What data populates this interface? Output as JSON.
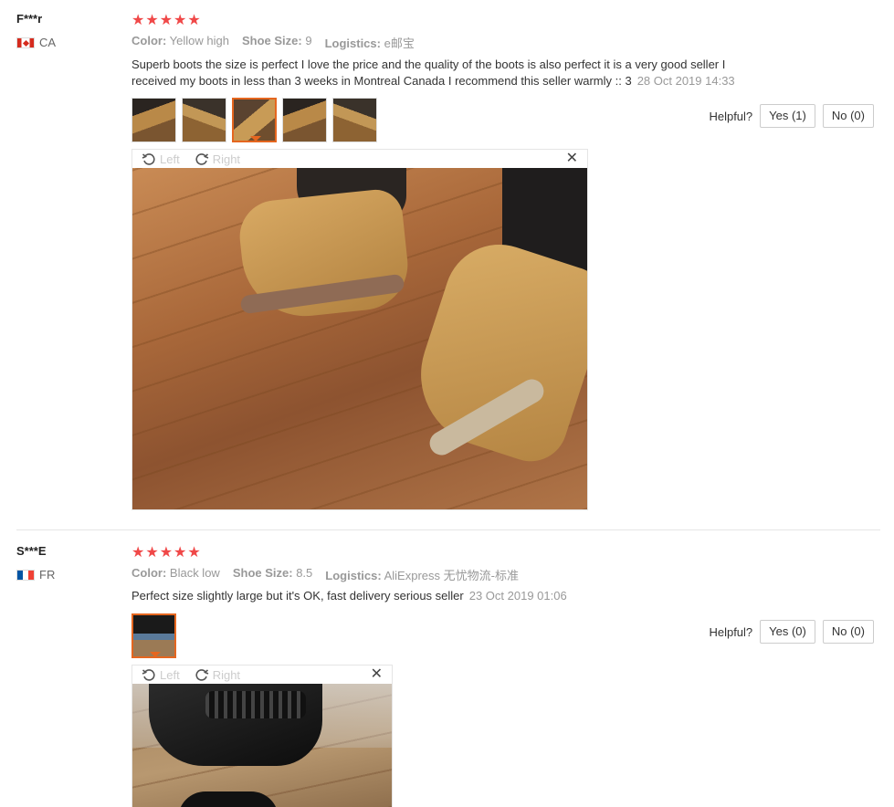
{
  "reviews": [
    {
      "user": "F***r",
      "country": "CA",
      "stars": "★★★★★",
      "attrs": [
        {
          "label": "Color:",
          "value": "Yellow high"
        },
        {
          "label": "Shoe Size:",
          "value": "9"
        },
        {
          "label": "Logistics:",
          "value": "e邮宝"
        }
      ],
      "text": "Superb boots the size is perfect I love the price and the quality of the boots is also perfect it is a very good seller I received my boots in less than 3 weeks in Montreal Canada I recommend this seller warmly :: 3",
      "date": "28 Oct 2019 14:33",
      "helpful_label": "Helpful?",
      "yes_label": "Yes (1)",
      "no_label": "No (0)"
    },
    {
      "user": "S***E",
      "country": "FR",
      "stars": "★★★★★",
      "attrs": [
        {
          "label": "Color:",
          "value": "Black low"
        },
        {
          "label": "Shoe Size:",
          "value": "8.5"
        },
        {
          "label": "Logistics:",
          "value": "AliExpress 无忧物流-标准"
        }
      ],
      "text": "Perfect size slightly large but it's OK, fast delivery serious seller",
      "date": "23 Oct 2019 01:06",
      "helpful_label": "Helpful?",
      "yes_label": "Yes (0)",
      "no_label": "No (0)"
    }
  ],
  "viewer": {
    "left_label": "Left",
    "right_label": "Right",
    "close_glyph": "✕"
  }
}
